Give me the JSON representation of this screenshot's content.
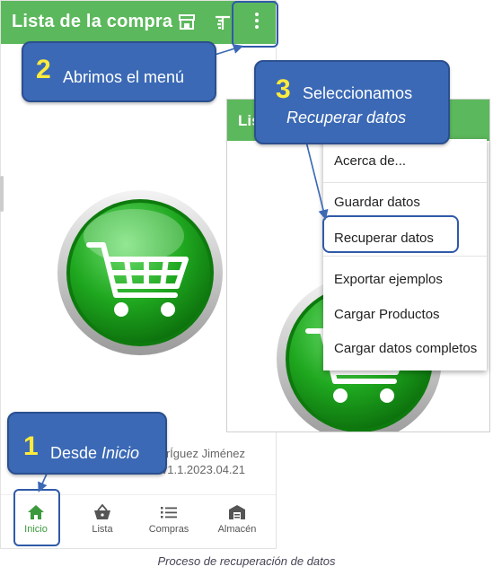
{
  "screen1": {
    "app_title": "Lista de la compra",
    "credit_name": "drÍguez Jiménez",
    "credit_version": "v1.1.2023.04.21",
    "nav": [
      {
        "label": "Inicio",
        "icon": "home-icon",
        "active": true
      },
      {
        "label": "Lista",
        "icon": "basket-icon",
        "active": false
      },
      {
        "label": "Compras",
        "icon": "list-icon",
        "active": false
      },
      {
        "label": "Almacén",
        "icon": "warehouse-icon",
        "active": false
      }
    ]
  },
  "screen2": {
    "app_title_partial": "Lis",
    "menu_items": [
      "Acerca de...",
      "Guardar datos",
      "Recuperar datos",
      "Exportar ejemplos",
      "Cargar Productos",
      "Cargar datos completos"
    ],
    "highlighted_item": "Recuperar datos"
  },
  "callouts": {
    "one": {
      "num": "1",
      "text": "Desde ",
      "text_italic": "Inicio"
    },
    "two": {
      "num": "2",
      "text": "Abrimos el menú"
    },
    "three": {
      "num": "3",
      "text": "Seleccionamos",
      "text_italic": "Recuperar datos"
    }
  },
  "caption": "Proceso de recuperación de datos",
  "colors": {
    "appbar": "#5cb85c",
    "callout": "#3b69b5",
    "callout_number": "#ffeb3b",
    "ring": "#2f5aa8",
    "nav_active": "#3c9a3c"
  }
}
